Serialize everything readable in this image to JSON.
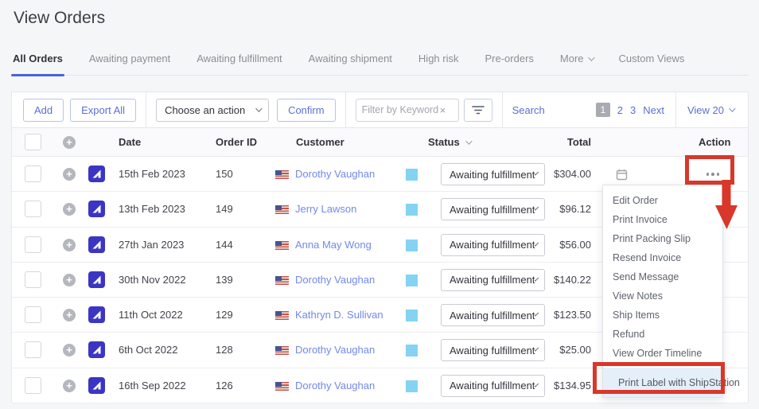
{
  "page": {
    "title": "View Orders"
  },
  "tabs": {
    "items": [
      {
        "label": "All Orders",
        "active": true,
        "chevron": false
      },
      {
        "label": "Awaiting payment",
        "active": false,
        "chevron": false
      },
      {
        "label": "Awaiting fulfillment",
        "active": false,
        "chevron": false
      },
      {
        "label": "Awaiting shipment",
        "active": false,
        "chevron": false
      },
      {
        "label": "High risk",
        "active": false,
        "chevron": false
      },
      {
        "label": "Pre-orders",
        "active": false,
        "chevron": false
      },
      {
        "label": "More",
        "active": false,
        "chevron": true
      },
      {
        "label": "Custom Views",
        "active": false,
        "chevron": false
      }
    ]
  },
  "toolbar": {
    "add_label": "Add",
    "export_label": "Export All",
    "action_select_value": "Choose an action",
    "confirm_label": "Confirm",
    "filter_placeholder": "Filter by Keyword",
    "clear_icon": "×",
    "search_label": "Search",
    "pagination": {
      "current": "1",
      "pages": [
        {
          "label": "2"
        },
        {
          "label": "3"
        }
      ],
      "next_label": "Next"
    },
    "view_select_value": "View 20"
  },
  "table": {
    "columns": {
      "date": "Date",
      "order_id": "Order ID",
      "customer": "Customer",
      "status": "Status",
      "total": "Total",
      "action": "Action"
    },
    "status_swatch_color": "#85d3f2",
    "rows": [
      {
        "date": "15th Feb 2023",
        "order_id": "150",
        "customer": "Dorothy Vaughan",
        "status": "Awaiting fulfillment",
        "total": "$304.00"
      },
      {
        "date": "13th Feb 2023",
        "order_id": "149",
        "customer": "Jerry Lawson",
        "status": "Awaiting fulfillment",
        "total": "$96.12"
      },
      {
        "date": "27th Jan 2023",
        "order_id": "144",
        "customer": "Anna May Wong",
        "status": "Awaiting fulfillment",
        "total": "$56.00"
      },
      {
        "date": "30th Nov 2022",
        "order_id": "139",
        "customer": "Dorothy Vaughan",
        "status": "Awaiting fulfillment",
        "total": "$140.22"
      },
      {
        "date": "11th Oct 2022",
        "order_id": "129",
        "customer": "Kathryn D. Sullivan",
        "status": "Awaiting fulfillment",
        "total": "$123.50"
      },
      {
        "date": "6th Oct 2022",
        "order_id": "128",
        "customer": "Dorothy Vaughan",
        "status": "Awaiting fulfillment",
        "total": "$25.00"
      },
      {
        "date": "16th Sep 2022",
        "order_id": "126",
        "customer": "Dorothy Vaughan",
        "status": "Awaiting fulfillment",
        "total": "$134.95"
      }
    ]
  },
  "menu": {
    "items": [
      {
        "label": "Edit Order"
      },
      {
        "label": "Print Invoice"
      },
      {
        "label": "Print Packing Slip"
      },
      {
        "label": "Resend Invoice"
      },
      {
        "label": "Send Message"
      },
      {
        "label": "View Notes"
      },
      {
        "label": "Ship Items"
      },
      {
        "label": "Refund"
      },
      {
        "label": "View Order Timeline"
      }
    ],
    "highlighted_item": {
      "label": "Print Label with ShipStation",
      "icon": "gear-icon"
    }
  },
  "icons": {
    "plus_circle": "expand-row-icon",
    "sales_channel": "sales-channel-icon",
    "us_flag": "us-flag-icon",
    "calendar": "calendar-icon",
    "filter": "filter-icon",
    "gear": "gear-icon",
    "ellipsis": "row-actions-icon"
  },
  "colors": {
    "accent_blue": "#5a6fd6",
    "link_blue": "#7289ea",
    "tab_underline": "#4b62d9",
    "status_swatch": "#85d3f2",
    "gear_green": "#7cb93e",
    "menu_highlight_bg": "#e4eff9",
    "annotation_red": "#d8372a",
    "pagination_current_bg": "#a9abb2"
  }
}
